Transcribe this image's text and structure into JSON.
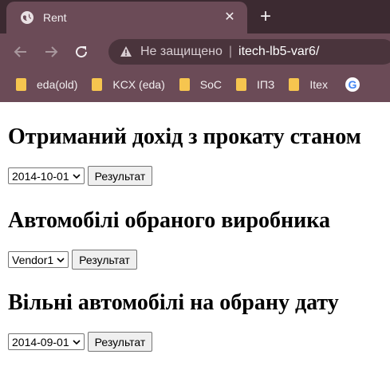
{
  "browser": {
    "tab_title": "Rent",
    "new_tab_symbol": "+",
    "close_symbol": "✕",
    "omnibox": {
      "security_text": "Не защищено",
      "separator": "|",
      "url": "itech-lb5-var6/"
    },
    "bookmarks": [
      {
        "label": "eda(old)"
      },
      {
        "label": "KCX (eda)"
      },
      {
        "label": "SoC"
      },
      {
        "label": "IПЗ"
      },
      {
        "label": "Itex"
      }
    ],
    "colors": {
      "frame": "#3c2a31",
      "toolbar": "#6b4b57",
      "omnibox": "#4a343c",
      "folder": "#f6c54f"
    }
  },
  "page": {
    "sections": [
      {
        "heading": "Отриманий дохід з прокату станом",
        "select_value": "2014-10-01",
        "button_label": "Результат"
      },
      {
        "heading": "Автомобілі обраного виробника",
        "select_value": "Vendor1",
        "button_label": "Результат"
      },
      {
        "heading": "Вільні автомобілі на обрану дату",
        "select_value": "2014-09-01",
        "button_label": "Результат"
      }
    ]
  }
}
